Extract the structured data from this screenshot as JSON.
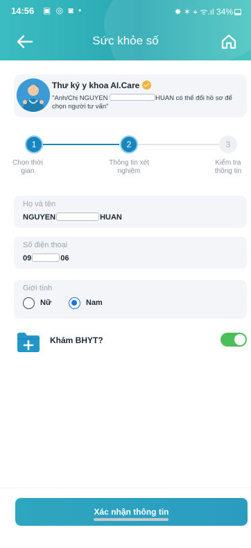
{
  "status": {
    "time": "14:56",
    "left_icons": "▣ ◎ ◙ •",
    "right_icons": "✸ ✶ ⌖ ᯤ.ıl",
    "battery": "34%"
  },
  "nav": {
    "title": "Sức khỏe số",
    "back_icon": "arrow-left-icon",
    "home_icon": "home-icon"
  },
  "assistant": {
    "name": "Thư ký y khoa AI.Care",
    "msg_part1": "\"Anh/Chị NGUYEN ",
    "msg_part2": "HUAN có thể đổi hồ sơ để chọn người tư vấn\""
  },
  "steps": [
    {
      "number": "1",
      "label": "Chọn thời gian"
    },
    {
      "number": "2",
      "label": "Thông tin xét nghiệm"
    },
    {
      "number": "3",
      "label": "Kiểm tra thông tin"
    }
  ],
  "form": {
    "name_label": "Họ và tên",
    "name_prefix": "NGUYEN",
    "name_suffix": "HUAN",
    "phone_label": "Số điện thoại",
    "phone_prefix": "09",
    "phone_suffix": "06",
    "gender_label": "Giới tính",
    "gender_options": [
      "Nữ",
      "Nam"
    ],
    "gender_selected": "Nam"
  },
  "bhyt": {
    "label": "Khám BHYT?",
    "enabled": true
  },
  "footer": {
    "confirm_label": "Xác nhận thông tin"
  },
  "colors": {
    "header": "#2aa8b2",
    "primary": "#1a86c0",
    "toggle_on": "#4cbf5a",
    "radio_selected": "#1a73e8"
  }
}
